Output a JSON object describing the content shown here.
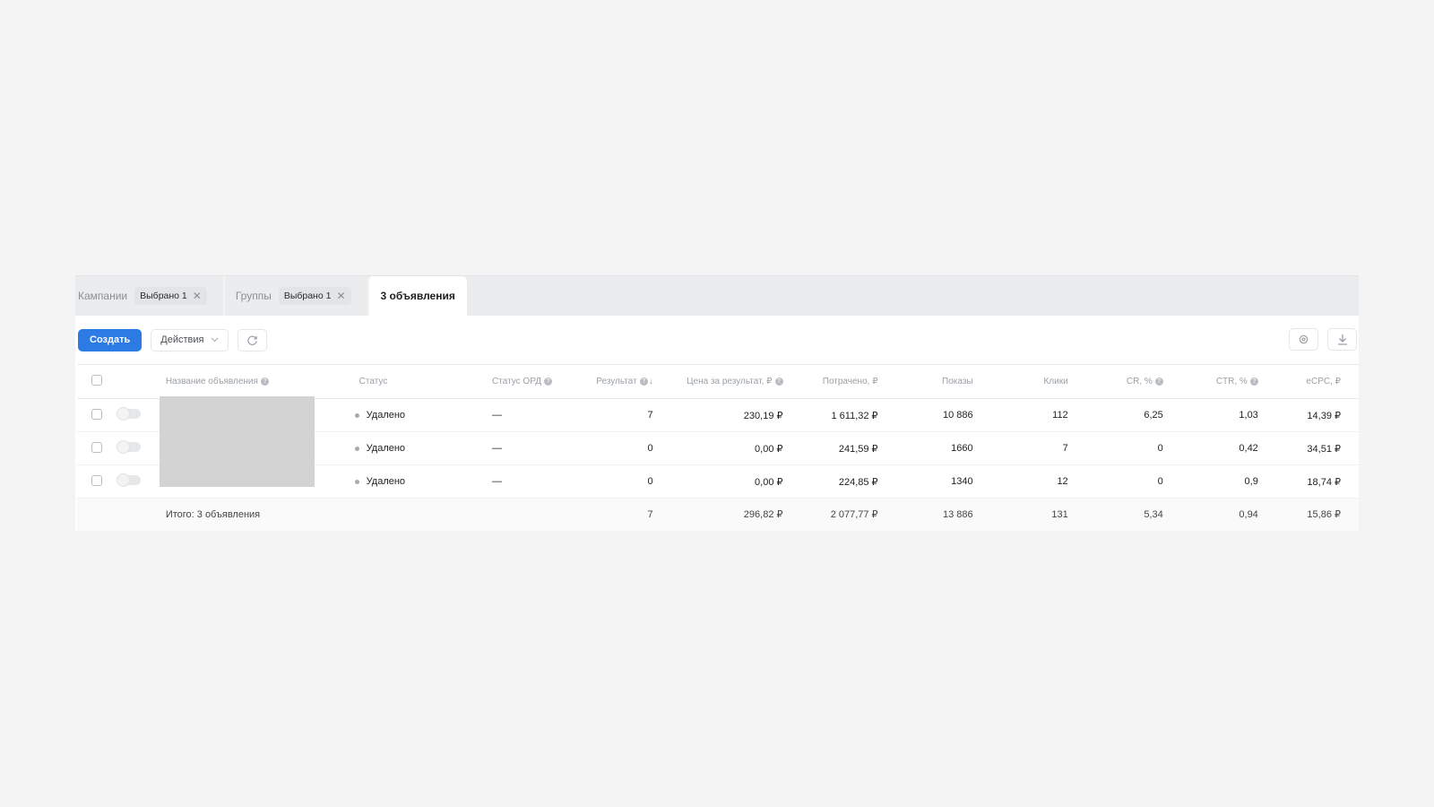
{
  "tabs": [
    {
      "label": "Кампании",
      "chip": "Выбрано 1"
    },
    {
      "label": "Группы",
      "chip": "Выбрано 1"
    },
    {
      "label": "3 объявления"
    }
  ],
  "toolbar": {
    "create_label": "Создать",
    "actions_label": "Действия"
  },
  "table": {
    "headers": {
      "name": "Название объявления",
      "status": "Статус",
      "ord_status": "Статус ОРД",
      "result": "Результат",
      "price_per_result": "Цена за результат, ₽",
      "spent": "Потрачено, ₽",
      "impressions": "Показы",
      "clicks": "Клики",
      "cr": "CR, %",
      "ctr": "CTR, %",
      "ecpc": "eCPC, ₽"
    },
    "rows": [
      {
        "status": "Удалено",
        "ord_status": "—",
        "result": "7",
        "price_per_result": "230,19 ₽",
        "spent": "1 611,32 ₽",
        "impressions": "10 886",
        "clicks": "112",
        "cr": "6,25",
        "ctr": "1,03",
        "ecpc": "14,39 ₽"
      },
      {
        "status": "Удалено",
        "ord_status": "—",
        "result": "0",
        "price_per_result": "0,00 ₽",
        "spent": "241,59 ₽",
        "impressions": "1660",
        "clicks": "7",
        "cr": "0",
        "ctr": "0,42",
        "ecpc": "34,51 ₽"
      },
      {
        "status": "Удалено",
        "ord_status": "—",
        "result": "0",
        "price_per_result": "0,00 ₽",
        "spent": "224,85 ₽",
        "impressions": "1340",
        "clicks": "12",
        "cr": "0",
        "ctr": "0,9",
        "ecpc": "18,74 ₽"
      }
    ],
    "totals": {
      "label": "Итого: 3 объявления",
      "result": "7",
      "price_per_result": "296,82 ₽",
      "spent": "2 077,77 ₽",
      "impressions": "13 886",
      "clicks": "131",
      "cr": "5,34",
      "ctr": "0,94",
      "ecpc": "15,86 ₽"
    }
  },
  "colors": {
    "accent": "#2c7be5",
    "page_bg": "#f4f4f5",
    "tabbar_bg": "#ebecee",
    "thumb_placeholder": "#d3d3d3"
  },
  "icons": [
    "close-icon",
    "chevron-down-icon",
    "refresh-icon",
    "settings-icon",
    "download-icon",
    "help-icon",
    "sort-down-icon"
  ]
}
